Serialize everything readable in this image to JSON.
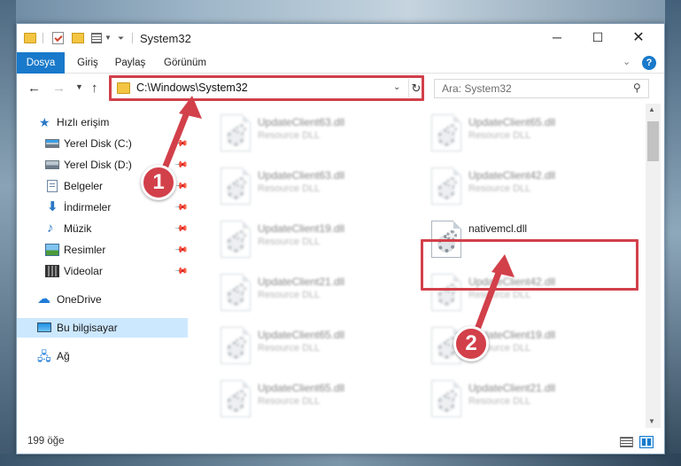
{
  "window": {
    "title": "System32",
    "minimize_glyph": "─",
    "maximize_glyph": "☐",
    "close_glyph": "✕"
  },
  "ribbon": {
    "tabs": [
      {
        "label": "Dosya",
        "active": true
      },
      {
        "label": "Giriş"
      },
      {
        "label": "Paylaş"
      },
      {
        "label": "Görünüm"
      }
    ],
    "help_glyph": "?"
  },
  "address": {
    "path": "C:\\Windows\\System32",
    "search_placeholder": "Ara: System32"
  },
  "sidebar": {
    "items": [
      {
        "label": "Hızlı erişim",
        "icon": "star-icon"
      },
      {
        "label": "Yerel Disk (C:)",
        "icon": "drive-icon",
        "pinned": true
      },
      {
        "label": "Yerel Disk (D:)",
        "icon": "drive-icon",
        "pinned": true
      },
      {
        "label": "Belgeler",
        "icon": "documents-icon",
        "pinned": true
      },
      {
        "label": "İndirmeler",
        "icon": "download-icon",
        "pinned": true
      },
      {
        "label": "Müzik",
        "icon": "music-icon",
        "pinned": true
      },
      {
        "label": "Resimler",
        "icon": "pictures-icon",
        "pinned": true
      },
      {
        "label": "Videolar",
        "icon": "videos-icon",
        "pinned": true
      },
      {
        "label": "OneDrive",
        "icon": "cloud-icon"
      },
      {
        "label": "Bu bilgisayar",
        "icon": "computer-icon",
        "selected": true
      },
      {
        "label": "Ağ",
        "icon": "network-icon"
      }
    ]
  },
  "files": {
    "left": [
      {
        "name": "UpdateClient63.dll",
        "type": "Resource DLL"
      },
      {
        "name": "UpdateClient63.dll",
        "type": "Resource DLL"
      },
      {
        "name": "UpdateClient19.dll",
        "type": "Resource DLL"
      },
      {
        "name": "UpdateClient21.dll",
        "type": "Resource DLL"
      },
      {
        "name": "UpdateClient65.dll",
        "type": "Resource DLL"
      },
      {
        "name": "UpdateClient65.dll",
        "type": "Resource DLL"
      }
    ],
    "right": [
      {
        "name": "UpdateClient65.dll",
        "type": "Resource DLL"
      },
      {
        "name": "UpdateClient42.dll",
        "type": "Resource DLL"
      },
      {
        "name": "nativemcl.dll",
        "type": "",
        "highlighted": true
      },
      {
        "name": "UpdateClient42.dll",
        "type": "Resource DLL"
      },
      {
        "name": "UpdateClient19.dll",
        "type": "Resource DLL"
      },
      {
        "name": "UpdateClient21.dll",
        "type": "Resource DLL"
      }
    ]
  },
  "status": {
    "item_count": "199 öğe"
  },
  "annotations": {
    "step1": "1",
    "step2": "2",
    "color": "#d2404a"
  }
}
